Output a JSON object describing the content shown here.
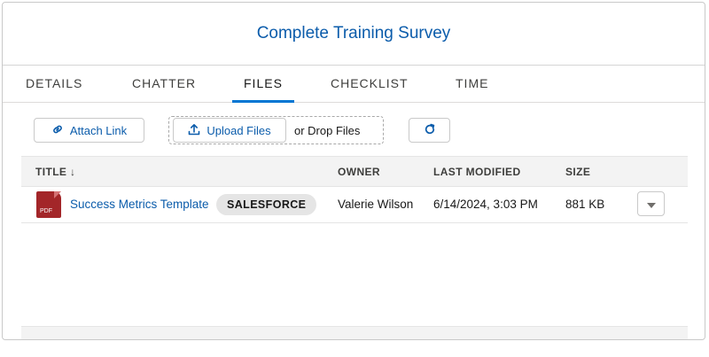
{
  "header": {
    "title": "Complete Training Survey"
  },
  "tabs": [
    {
      "label": "DETAILS",
      "active": false
    },
    {
      "label": "CHATTER",
      "active": false
    },
    {
      "label": "FILES",
      "active": true
    },
    {
      "label": "CHECKLIST",
      "active": false
    },
    {
      "label": "TIME",
      "active": false
    }
  ],
  "toolbar": {
    "attach_link": "Attach Link",
    "upload_files": "Upload Files",
    "drop_files": "or Drop Files"
  },
  "table": {
    "columns": [
      "TITLE ↓",
      "OWNER",
      "LAST MODIFIED",
      "SIZE"
    ],
    "rows": [
      {
        "icon_label": "PDF",
        "title": "Success Metrics Template",
        "source_badge": "SALESFORCE",
        "owner": "Valerie Wilson",
        "last_modified": "6/14/2024, 3:03 PM",
        "size": "881 KB"
      }
    ]
  },
  "colors": {
    "brand_blue": "#0176d3",
    "link_blue": "#0b5cab",
    "pdf_red": "#a32629"
  },
  "icons": [
    "link-icon",
    "upload-icon",
    "refresh-icon",
    "pdf-file-icon",
    "chevron-down-icon"
  ]
}
